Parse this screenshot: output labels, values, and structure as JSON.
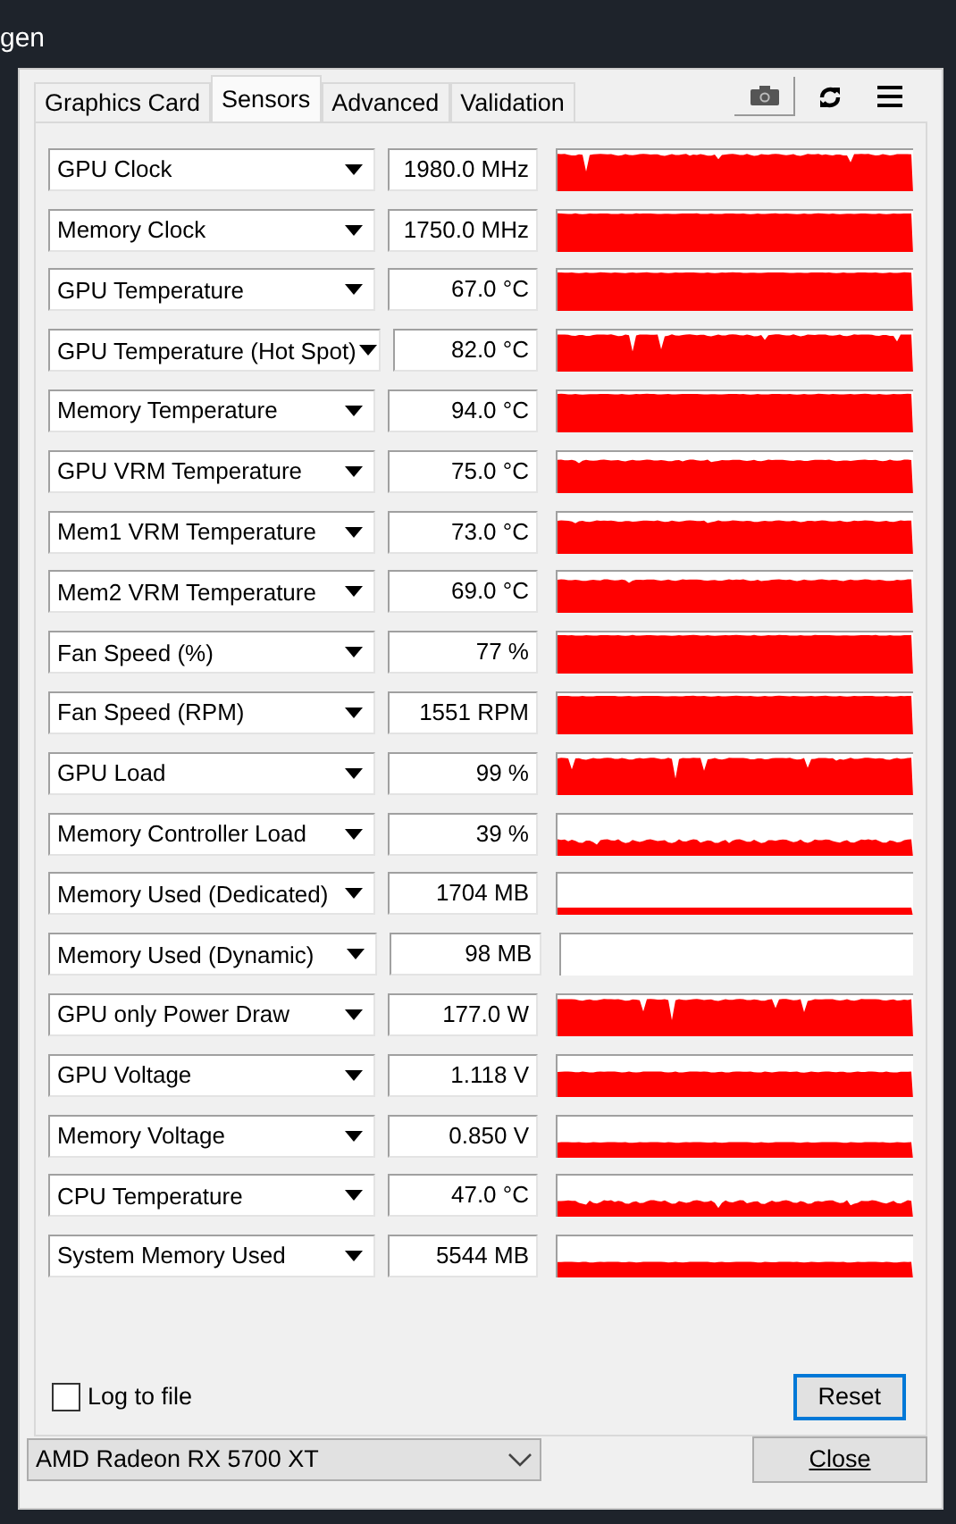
{
  "background": {
    "title": "gen"
  },
  "tabs": [
    {
      "label": "Graphics Card",
      "selected": false
    },
    {
      "label": "Sensors",
      "selected": true
    },
    {
      "label": "Advanced",
      "selected": false
    },
    {
      "label": "Validation",
      "selected": false
    }
  ],
  "sensors": [
    {
      "name": "GPU Clock",
      "value": "1980.0 MHz",
      "kind": "spiky"
    },
    {
      "name": "Memory Clock",
      "value": "1750.0 MHz",
      "kind": "full"
    },
    {
      "name": "GPU Temperature",
      "value": "67.0 °C",
      "kind": "full"
    },
    {
      "name": "GPU Temperature (Hot Spot)",
      "value": "82.0 °C",
      "kind": "spiky"
    },
    {
      "name": "Memory Temperature",
      "value": "94.0 °C",
      "kind": "full"
    },
    {
      "name": "GPU VRM Temperature",
      "value": "75.0 °C",
      "kind": "high"
    },
    {
      "name": "Mem1 VRM Temperature",
      "value": "73.0 °C",
      "kind": "high"
    },
    {
      "name": "Mem2 VRM Temperature",
      "value": "69.0 °C",
      "kind": "high"
    },
    {
      "name": "Fan Speed (%)",
      "value": "77 %",
      "kind": "full"
    },
    {
      "name": "Fan Speed (RPM)",
      "value": "1551 RPM",
      "kind": "full"
    },
    {
      "name": "GPU Load",
      "value": "99 %",
      "kind": "spiky"
    },
    {
      "name": "Memory Controller Load",
      "value": "39 %",
      "kind": "noisy"
    },
    {
      "name": "Memory Used (Dedicated)",
      "value": "1704 MB",
      "kind": "line"
    },
    {
      "name": "Memory Used (Dynamic)",
      "value": "98 MB",
      "kind": "empty"
    },
    {
      "name": "GPU only Power Draw",
      "value": "177.0 W",
      "kind": "spiky"
    },
    {
      "name": "GPU Voltage",
      "value": "1.118 V",
      "kind": "medium"
    },
    {
      "name": "Memory Voltage",
      "value": "0.850 V",
      "kind": "low"
    },
    {
      "name": "CPU Temperature",
      "value": "47.0 °C",
      "kind": "noisy"
    },
    {
      "name": "System Memory Used",
      "value": "5544 MB",
      "kind": "low"
    }
  ],
  "log_to_file": {
    "label": "Log to file",
    "checked": false
  },
  "reset_button": "Reset",
  "device_select": {
    "value": "AMD Radeon RX 5700 XT"
  },
  "close_button": "Close"
}
